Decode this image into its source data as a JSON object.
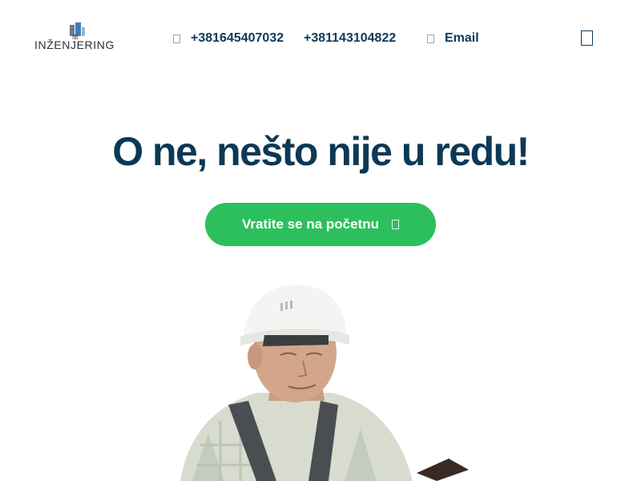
{
  "colors": {
    "brand_dark": "#0c3955",
    "accent_green": "#2dbf5e",
    "background": "#ffffff"
  },
  "header": {
    "logo": {
      "mark_text": "IB",
      "text": "INŽENJERING"
    },
    "contacts": [
      {
        "icon": "phone-icon",
        "label": "+381645407032"
      },
      {
        "icon": "phone-icon",
        "label": "+381143104822"
      },
      {
        "icon": "email-icon",
        "label": "Email"
      }
    ],
    "menu_icon": "menu-icon"
  },
  "main": {
    "title": "O ne, nešto nije u redu!",
    "cta_label": "Vratite se na početnu",
    "cta_icon": "arrow-right-icon",
    "image": "worker-in-hard-hat-photo"
  }
}
